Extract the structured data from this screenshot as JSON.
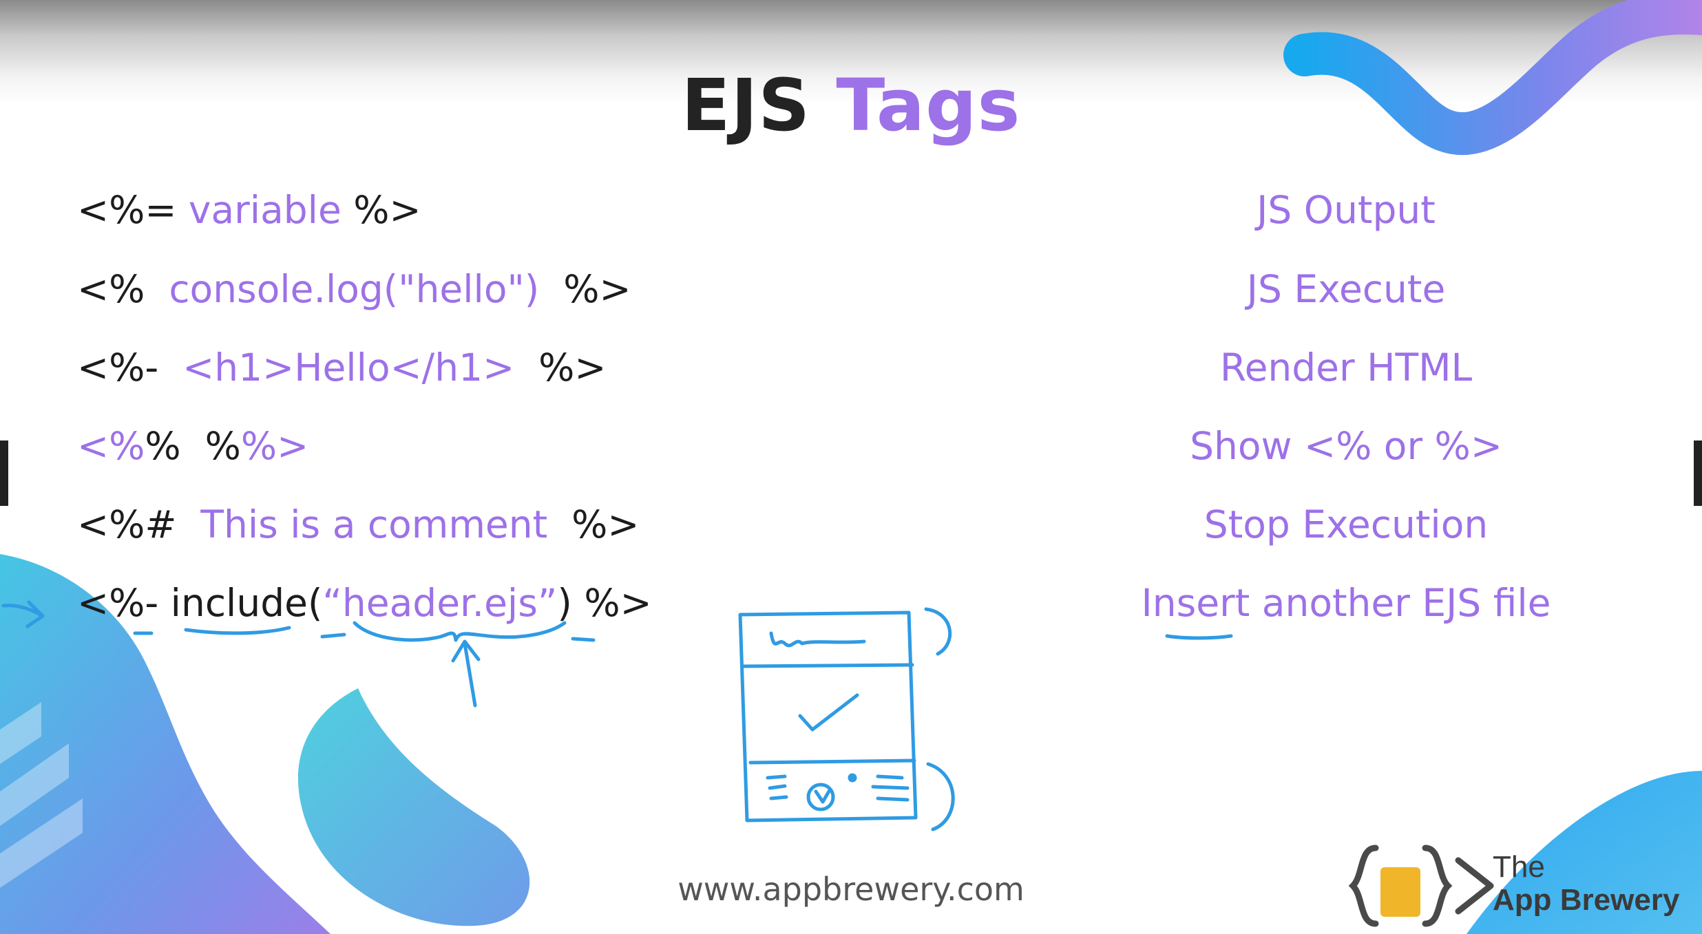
{
  "title": {
    "word1": "EJS",
    "word2": "Tags"
  },
  "rows": [
    {
      "code": {
        "a": "<%= ",
        "b": "variable",
        "c": " %>"
      },
      "desc": "JS Output"
    },
    {
      "code": {
        "a": "<%  ",
        "b": "console.log(\"hello\")",
        "c": "  %>"
      },
      "desc": "JS Execute"
    },
    {
      "code": {
        "a": "<%-  ",
        "b": "<h1>Hello</h1>",
        "c": "  %>"
      },
      "desc": "Render HTML"
    },
    {
      "code": {
        "a": "<%",
        "b": "%  %",
        "c": "%>"
      },
      "desc": "Show <% or %>"
    },
    {
      "code": {
        "a": "<%#  ",
        "b": "This is a comment",
        "c": "  %>"
      },
      "desc": "Stop Execution"
    },
    {
      "code": {
        "a": "<%- include(",
        "b": "“header.ejs”",
        "c": ") %>"
      },
      "desc": "Insert another EJS file"
    }
  ],
  "footer": {
    "url": "www.appbrewery.com"
  },
  "logo": {
    "line1": "The",
    "line2": "App Brewery"
  },
  "colors": {
    "accent": "#9d71e8",
    "dark": "#1c1c1c",
    "annotation": "#2f9be3",
    "blob": "#5fc7e6"
  }
}
